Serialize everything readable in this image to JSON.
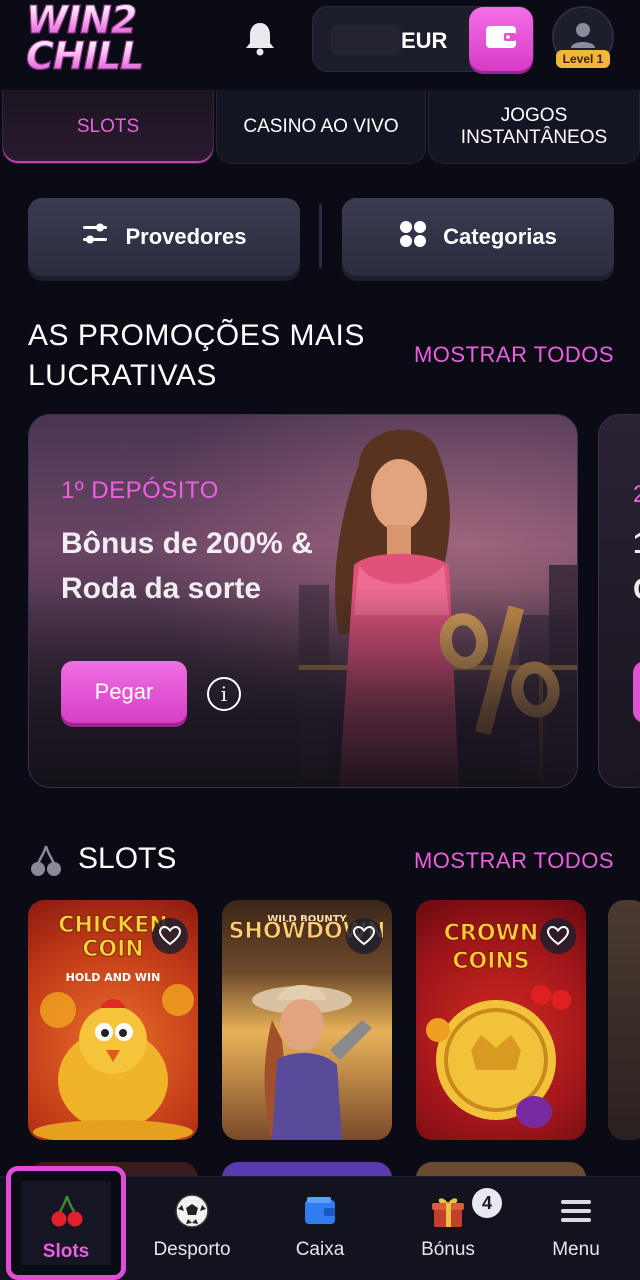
{
  "header": {
    "logo_line1": "WIN2",
    "logo_line2": "CHILL",
    "currency": "EUR",
    "level": "Level 1"
  },
  "tabs": [
    {
      "label": "SLOTS",
      "active": true
    },
    {
      "label": "CASINO AO VIVO",
      "active": false
    },
    {
      "label": "JOGOS INSTANTÂNEOS",
      "active": false
    }
  ],
  "filters": {
    "providers": "Provedores",
    "categories": "Categorias"
  },
  "promotions": {
    "title": "AS PROMOÇÕES MAIS LUCRATIVAS",
    "show_all": "MOSTRAR TODOS",
    "card": {
      "label": "1º DEPÓSITO",
      "title": "Bônus de 200% & Roda da sorte",
      "button": "Pegar"
    },
    "peek": {
      "label": "2",
      "line1": "1",
      "line2": "C"
    }
  },
  "slots": {
    "title": "SLOTS",
    "show_all": "MOSTRAR TODOS",
    "games": [
      {
        "name": "CHICKEN COIN",
        "subtitle": "HOLD AND WIN"
      },
      {
        "name": "SHOWDOWN",
        "subtitle": "WILD BOUNTY"
      },
      {
        "name": "CROWN COINS",
        "subtitle": ""
      }
    ]
  },
  "bottom_nav": {
    "items": [
      {
        "label": "Slots",
        "icon": "cherries-icon",
        "active": true
      },
      {
        "label": "Desporto",
        "icon": "soccer-ball-icon",
        "active": false
      },
      {
        "label": "Caixa",
        "icon": "wallet-icon",
        "active": false
      },
      {
        "label": "Bónus",
        "icon": "gift-icon",
        "active": false
      },
      {
        "label": "Menu",
        "icon": "hamburger-icon",
        "active": false
      }
    ],
    "bonus_count": "4"
  },
  "colors": {
    "accent": "#ee5fe0",
    "background": "#0b0b16",
    "level_badge": "#f3b53a"
  }
}
